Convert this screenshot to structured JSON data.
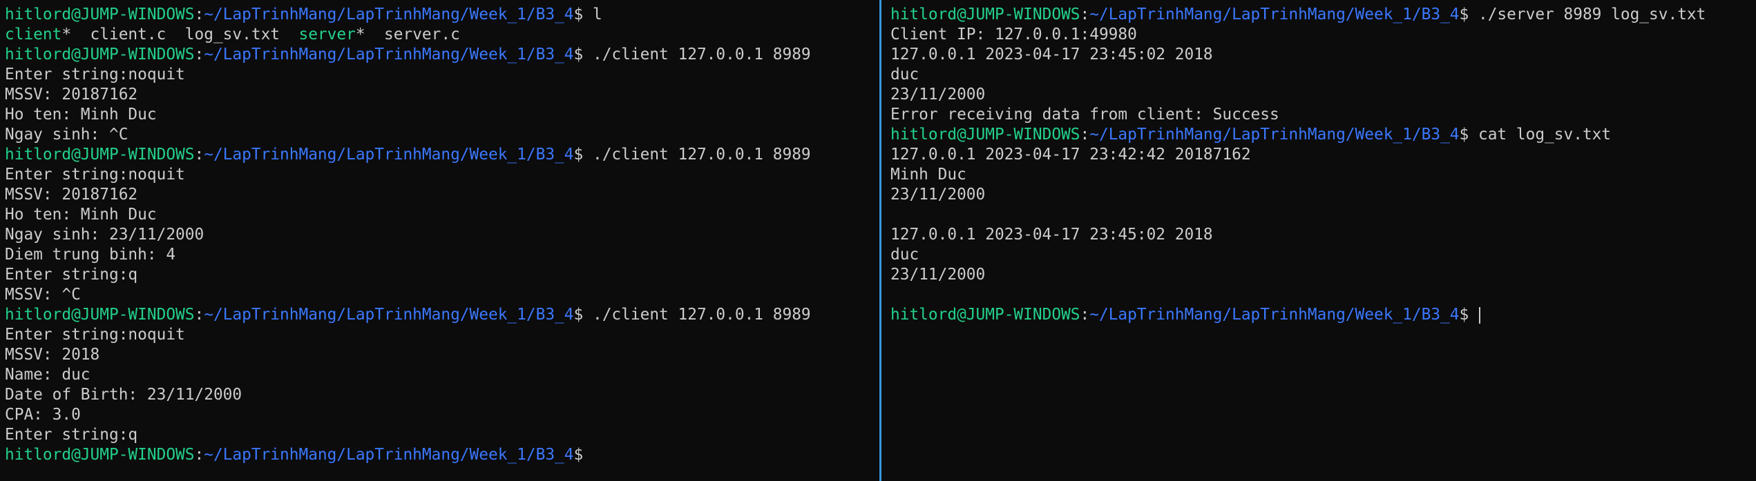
{
  "prompt": {
    "user": "hitlord@JUMP-WINDOWS",
    "sep": ":",
    "path": "~/LapTrinhMang/LapTrinhMang/Week_1/B3_4",
    "dollar": "$ "
  },
  "left_terminal": {
    "lines": [
      {
        "type": "prompt",
        "cmd": "l"
      },
      {
        "type": "ls",
        "tokens": [
          {
            "text": "client",
            "color": "green"
          },
          {
            "text": "*  client.c  log_sv.txt  ",
            "color": "plain"
          },
          {
            "text": "server",
            "color": "green"
          },
          {
            "text": "*  server.c",
            "color": "plain"
          }
        ]
      },
      {
        "type": "prompt",
        "cmd": "./client 127.0.0.1 8989"
      },
      {
        "type": "output",
        "text": "Enter string:noquit"
      },
      {
        "type": "output",
        "text": "MSSV: 20187162"
      },
      {
        "type": "output",
        "text": "Ho ten: Minh Duc"
      },
      {
        "type": "output",
        "text": "Ngay sinh: ^C"
      },
      {
        "type": "prompt",
        "cmd": "./client 127.0.0.1 8989"
      },
      {
        "type": "output",
        "text": "Enter string:noquit"
      },
      {
        "type": "output",
        "text": "MSSV: 20187162"
      },
      {
        "type": "output",
        "text": "Ho ten: Minh Duc"
      },
      {
        "type": "output",
        "text": "Ngay sinh: 23/11/2000"
      },
      {
        "type": "output",
        "text": "Diem trung binh: 4"
      },
      {
        "type": "output",
        "text": "Enter string:q"
      },
      {
        "type": "output",
        "text": "MSSV: ^C"
      },
      {
        "type": "prompt",
        "cmd": "./client 127.0.0.1 8989"
      },
      {
        "type": "output",
        "text": "Enter string:noquit"
      },
      {
        "type": "output",
        "text": "MSSV: 2018"
      },
      {
        "type": "output",
        "text": "Name: duc"
      },
      {
        "type": "output",
        "text": "Date of Birth: 23/11/2000"
      },
      {
        "type": "output",
        "text": "CPA: 3.0"
      },
      {
        "type": "output",
        "text": "Enter string:q"
      },
      {
        "type": "prompt",
        "cmd": ""
      }
    ]
  },
  "right_terminal": {
    "lines": [
      {
        "type": "prompt",
        "cmd": "./server 8989 log_sv.txt"
      },
      {
        "type": "output",
        "text": "Client IP: 127.0.0.1:49980"
      },
      {
        "type": "output",
        "text": "127.0.0.1 2023-04-17 23:45:02 2018"
      },
      {
        "type": "output",
        "text": "duc"
      },
      {
        "type": "output",
        "text": "23/11/2000"
      },
      {
        "type": "output",
        "text": "Error receiving data from client: Success"
      },
      {
        "type": "prompt",
        "cmd": "cat log_sv.txt"
      },
      {
        "type": "output",
        "text": "127.0.0.1 2023-04-17 23:42:42 20187162"
      },
      {
        "type": "output",
        "text": "Minh Duc"
      },
      {
        "type": "output",
        "text": "23/11/2000"
      },
      {
        "type": "output",
        "text": ""
      },
      {
        "type": "output",
        "text": "127.0.0.1 2023-04-17 23:45:02 2018"
      },
      {
        "type": "output",
        "text": "duc"
      },
      {
        "type": "output",
        "text": "23/11/2000"
      },
      {
        "type": "output",
        "text": ""
      },
      {
        "type": "prompt",
        "cmd": "",
        "cursor": true
      }
    ]
  },
  "colors": {
    "background": "#0c0c0c",
    "text": "#cccccc",
    "user_green": "#23d18b",
    "path_blue": "#3b78ff",
    "divider": "#3a96dd"
  }
}
